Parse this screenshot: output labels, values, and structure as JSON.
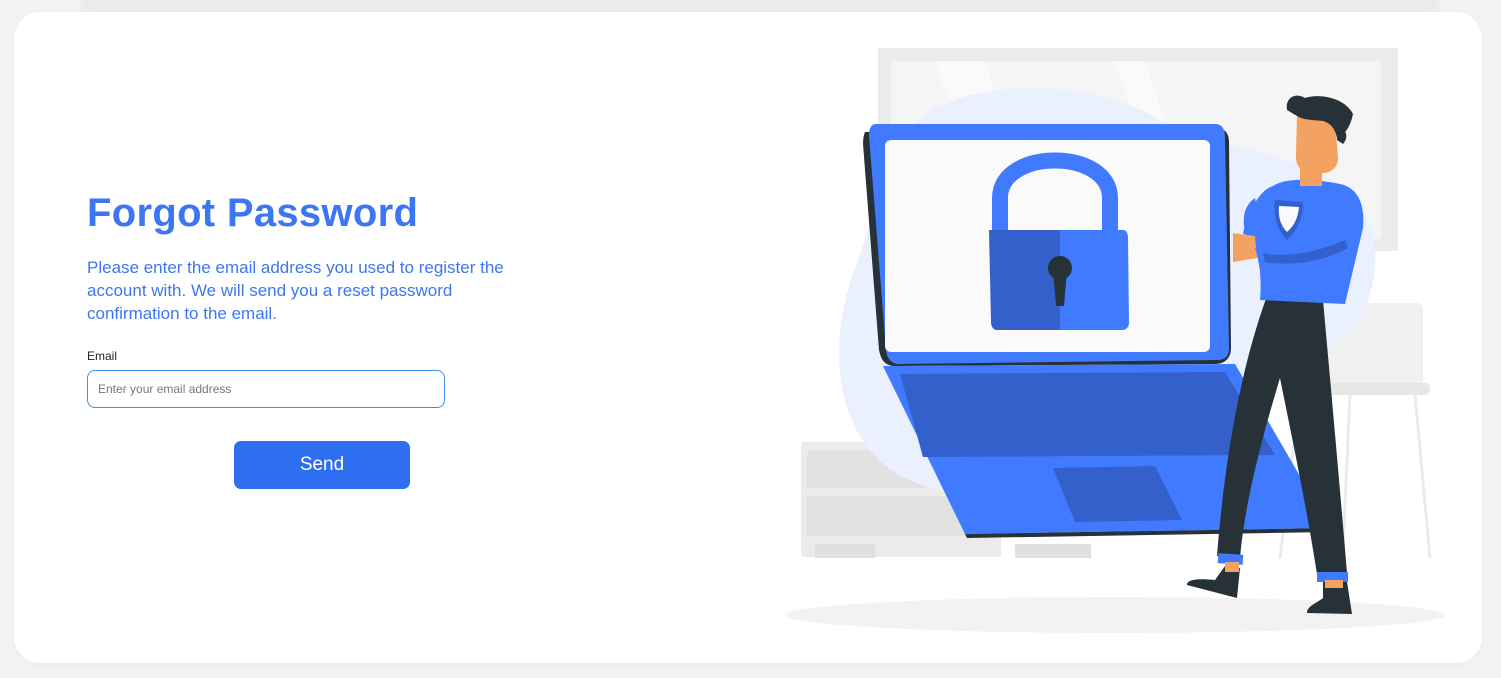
{
  "form": {
    "title": "Forgot Password",
    "description": "Please enter the email address you used to register the account with. We will send you a reset password confirmation to the email.",
    "email_label": "Email",
    "email_placeholder": "Enter your email address",
    "email_value": "",
    "send_label": "Send"
  },
  "colors": {
    "accent": "#3d76f2",
    "button": "#2e6ff2",
    "illustration_dark": "#263238"
  },
  "illustration": {
    "subject": "person-leaning-on-laptop-with-padlock",
    "icons": [
      "padlock-icon",
      "shield-icon"
    ]
  }
}
